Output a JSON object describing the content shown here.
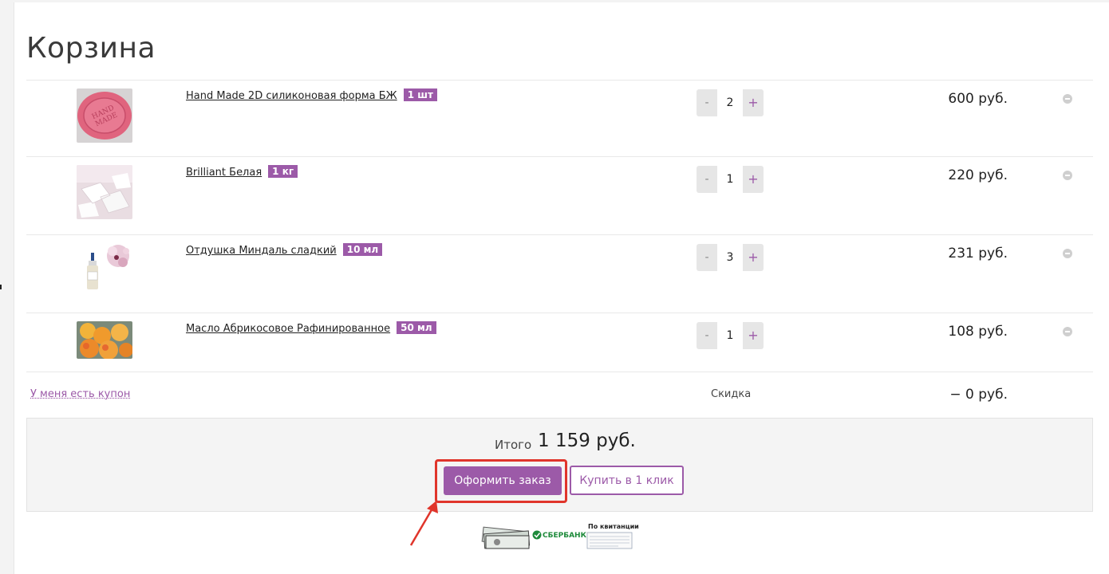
{
  "page": {
    "title": "Корзина"
  },
  "cart": {
    "items": [
      {
        "name": "Hand Made 2D силиконовая форма БЖ",
        "unit": "1 шт",
        "qty": "2",
        "price": "600 руб.",
        "image": "pink-soap-mold"
      },
      {
        "name": "Brilliant Белая",
        "unit": "1 кг",
        "qty": "1",
        "price": "220 руб.",
        "image": "white-soap-base"
      },
      {
        "name": "Отдушка Миндаль сладкий",
        "unit": "10 мл",
        "qty": "3",
        "price": "231 руб.",
        "image": "almond-fragrance-bottle"
      },
      {
        "name": "Масло Абрикосовое Рафинированное",
        "unit": "50 мл",
        "qty": "1",
        "price": "108 руб.",
        "image": "apricots"
      }
    ],
    "minus_label": "-",
    "plus_label": "+"
  },
  "coupon": {
    "link_text": "У меня есть купон"
  },
  "discount": {
    "label": "Скидка",
    "value": "− 0 руб."
  },
  "total": {
    "label": "Итого",
    "value": "1 159 руб.",
    "checkout_label": "Оформить заказ",
    "one_click_label": "Купить в 1 клик"
  },
  "payment": {
    "sber_label": "СБЕРБАНК",
    "receipt_label": "По квитанции"
  },
  "colors": {
    "accent": "#9c5aa8",
    "highlight": "#e0352b"
  }
}
